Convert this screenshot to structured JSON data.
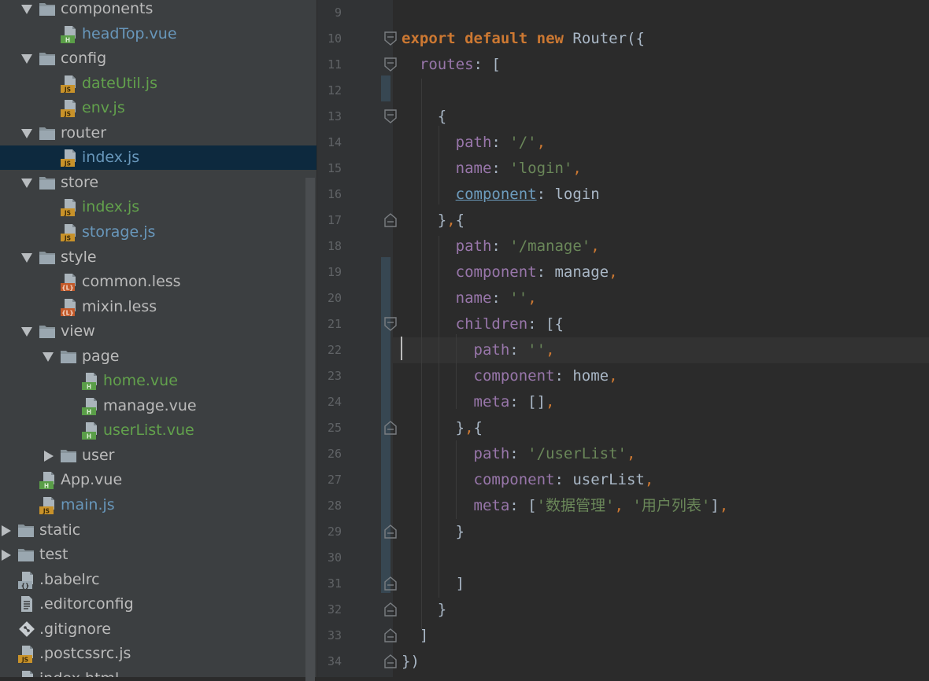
{
  "tree": {
    "items": [
      {
        "label": "components",
        "kind": "folder",
        "arrow": "down",
        "depth": 1,
        "color": "gray"
      },
      {
        "label": "headTop.vue",
        "kind": "vue",
        "depth": 2,
        "color": "blue"
      },
      {
        "label": "config",
        "kind": "folder",
        "arrow": "down",
        "depth": 1,
        "color": "gray"
      },
      {
        "label": "dateUtil.js",
        "kind": "js",
        "depth": 2,
        "color": "green"
      },
      {
        "label": "env.js",
        "kind": "js",
        "depth": 2,
        "color": "green"
      },
      {
        "label": "router",
        "kind": "folder",
        "arrow": "down",
        "depth": 1,
        "color": "gray"
      },
      {
        "label": "index.js",
        "kind": "js",
        "depth": 2,
        "color": "blue",
        "selected": true
      },
      {
        "label": "store",
        "kind": "folder",
        "arrow": "down",
        "depth": 1,
        "color": "gray"
      },
      {
        "label": "index.js",
        "kind": "js",
        "depth": 2,
        "color": "green"
      },
      {
        "label": "storage.js",
        "kind": "js",
        "depth": 2,
        "color": "blue"
      },
      {
        "label": "style",
        "kind": "folder",
        "arrow": "down",
        "depth": 1,
        "color": "gray"
      },
      {
        "label": "common.less",
        "kind": "less",
        "depth": 2,
        "color": "gray"
      },
      {
        "label": "mixin.less",
        "kind": "less",
        "depth": 2,
        "color": "gray"
      },
      {
        "label": "view",
        "kind": "folder",
        "arrow": "down",
        "depth": 1,
        "color": "gray"
      },
      {
        "label": "page",
        "kind": "folder",
        "arrow": "down",
        "depth": 2,
        "color": "gray"
      },
      {
        "label": "home.vue",
        "kind": "vue",
        "depth": 3,
        "color": "green"
      },
      {
        "label": "manage.vue",
        "kind": "vue",
        "depth": 3,
        "color": "gray"
      },
      {
        "label": "userList.vue",
        "kind": "vue",
        "depth": 3,
        "color": "green"
      },
      {
        "label": "user",
        "kind": "folder",
        "arrow": "right",
        "depth": 2,
        "color": "gray"
      },
      {
        "label": "App.vue",
        "kind": "vue",
        "depth": 1,
        "color": "gray"
      },
      {
        "label": "main.js",
        "kind": "js",
        "depth": 1,
        "color": "blue"
      },
      {
        "label": "static",
        "kind": "folder",
        "arrow": "right",
        "depth": 0,
        "color": "gray"
      },
      {
        "label": "test",
        "kind": "folder",
        "arrow": "right",
        "depth": 0,
        "color": "gray"
      },
      {
        "label": ".babelrc",
        "kind": "json",
        "depth": 0,
        "color": "gray"
      },
      {
        "label": ".editorconfig",
        "kind": "text",
        "depth": 0,
        "color": "gray"
      },
      {
        "label": ".gitignore",
        "kind": "git",
        "depth": 0,
        "color": "gray"
      },
      {
        "label": ".postcssrc.js",
        "kind": "js",
        "depth": 0,
        "color": "gray"
      },
      {
        "label": "index.html",
        "kind": "html",
        "depth": 0,
        "color": "gray"
      }
    ]
  },
  "editor": {
    "line_numbers": [
      "9",
      "10",
      "11",
      "12",
      "13",
      "14",
      "15",
      "16",
      "17",
      "18",
      "19",
      "20",
      "21",
      "22",
      "23",
      "24",
      "25",
      "26",
      "27",
      "28",
      "29",
      "30",
      "31",
      "32",
      "33",
      "34"
    ],
    "current_line": "22",
    "lines": [
      [],
      [
        {
          "t": "export",
          "c": "kw"
        },
        {
          "t": " ",
          "c": "plain"
        },
        {
          "t": "default",
          "c": "kw"
        },
        {
          "t": " ",
          "c": "plain"
        },
        {
          "t": "new",
          "c": "kw"
        },
        {
          "t": " Router({",
          "c": "plain"
        }
      ],
      [
        {
          "t": "  ",
          "c": "plain"
        },
        {
          "t": "routes",
          "c": "prop"
        },
        {
          "t": ": [",
          "c": "plain"
        }
      ],
      [],
      [
        {
          "t": "    {",
          "c": "plain"
        }
      ],
      [
        {
          "t": "      ",
          "c": "plain"
        },
        {
          "t": "path",
          "c": "prop"
        },
        {
          "t": ": ",
          "c": "plain"
        },
        {
          "t": "'/'",
          "c": "str"
        },
        {
          "t": ",",
          "c": "punc"
        }
      ],
      [
        {
          "t": "      ",
          "c": "plain"
        },
        {
          "t": "name",
          "c": "prop"
        },
        {
          "t": ": ",
          "c": "plain"
        },
        {
          "t": "'login'",
          "c": "str"
        },
        {
          "t": ",",
          "c": "punc"
        }
      ],
      [
        {
          "t": "      ",
          "c": "plain"
        },
        {
          "t": "component",
          "c": "link"
        },
        {
          "t": ": login",
          "c": "plain"
        }
      ],
      [
        {
          "t": "    }",
          "c": "plain"
        },
        {
          "t": ",",
          "c": "punc"
        },
        {
          "t": "{",
          "c": "plain"
        }
      ],
      [
        {
          "t": "      ",
          "c": "plain"
        },
        {
          "t": "path",
          "c": "prop"
        },
        {
          "t": ": ",
          "c": "plain"
        },
        {
          "t": "'/manage'",
          "c": "str"
        },
        {
          "t": ",",
          "c": "punc"
        }
      ],
      [
        {
          "t": "      ",
          "c": "plain"
        },
        {
          "t": "component",
          "c": "prop"
        },
        {
          "t": ": manage",
          "c": "plain"
        },
        {
          "t": ",",
          "c": "punc"
        }
      ],
      [
        {
          "t": "      ",
          "c": "plain"
        },
        {
          "t": "name",
          "c": "prop"
        },
        {
          "t": ": ",
          "c": "plain"
        },
        {
          "t": "''",
          "c": "str"
        },
        {
          "t": ",",
          "c": "punc"
        }
      ],
      [
        {
          "t": "      ",
          "c": "plain"
        },
        {
          "t": "children",
          "c": "prop"
        },
        {
          "t": ": [{",
          "c": "plain"
        }
      ],
      [
        {
          "t": "        ",
          "c": "plain"
        },
        {
          "t": "path",
          "c": "prop"
        },
        {
          "t": ": ",
          "c": "plain"
        },
        {
          "t": "''",
          "c": "str"
        },
        {
          "t": ",",
          "c": "punc"
        }
      ],
      [
        {
          "t": "        ",
          "c": "plain"
        },
        {
          "t": "component",
          "c": "prop"
        },
        {
          "t": ": home",
          "c": "plain"
        },
        {
          "t": ",",
          "c": "punc"
        }
      ],
      [
        {
          "t": "        ",
          "c": "plain"
        },
        {
          "t": "meta",
          "c": "prop"
        },
        {
          "t": ": []",
          "c": "plain"
        },
        {
          "t": ",",
          "c": "punc"
        }
      ],
      [
        {
          "t": "      }",
          "c": "plain"
        },
        {
          "t": ",",
          "c": "punc"
        },
        {
          "t": "{",
          "c": "plain"
        }
      ],
      [
        {
          "t": "        ",
          "c": "plain"
        },
        {
          "t": "path",
          "c": "prop"
        },
        {
          "t": ": ",
          "c": "plain"
        },
        {
          "t": "'/userList'",
          "c": "str"
        },
        {
          "t": ",",
          "c": "punc"
        }
      ],
      [
        {
          "t": "        ",
          "c": "plain"
        },
        {
          "t": "component",
          "c": "prop"
        },
        {
          "t": ": userList",
          "c": "plain"
        },
        {
          "t": ",",
          "c": "punc"
        }
      ],
      [
        {
          "t": "        ",
          "c": "plain"
        },
        {
          "t": "meta",
          "c": "prop"
        },
        {
          "t": ": [",
          "c": "plain"
        },
        {
          "t": "'数据管理'",
          "c": "str"
        },
        {
          "t": ", ",
          "c": "punc"
        },
        {
          "t": "'用户列表'",
          "c": "str"
        },
        {
          "t": "]",
          "c": "plain"
        },
        {
          "t": ",",
          "c": "punc"
        }
      ],
      [
        {
          "t": "      }",
          "c": "plain"
        }
      ],
      [],
      [
        {
          "t": "      ]",
          "c": "plain"
        }
      ],
      [
        {
          "t": "    }",
          "c": "plain"
        }
      ],
      [
        {
          "t": "  ]",
          "c": "plain"
        }
      ],
      [
        {
          "t": "})",
          "c": "plain"
        }
      ]
    ]
  },
  "colors": {
    "tree_bg": "#3c3f41",
    "selected_row": "#0d293e",
    "editor_bg": "#2b2b2b",
    "gutter_bg": "#313335",
    "keyword": "#cc7832",
    "property": "#9876aa",
    "string": "#6a8759",
    "file_blue": "#6897bb",
    "file_green": "#62a14c"
  }
}
